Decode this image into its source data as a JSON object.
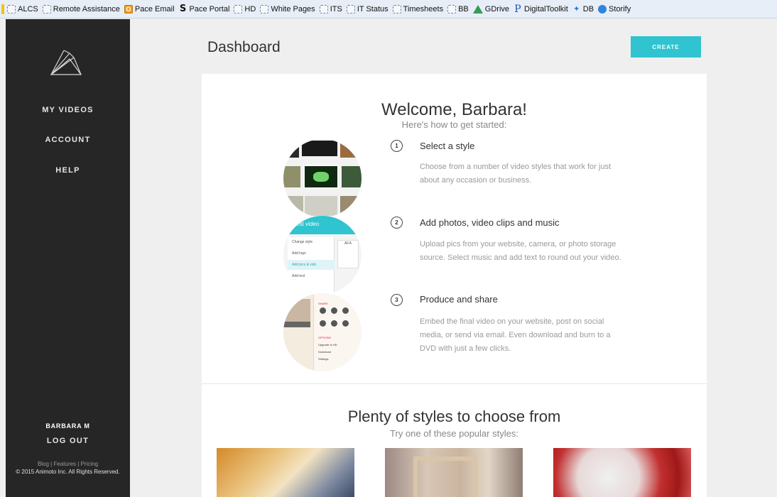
{
  "bookmarks": [
    {
      "label": "ALCS",
      "icon": "folder-icon"
    },
    {
      "label": "Remote Assistance",
      "icon": "folder-icon"
    },
    {
      "label": "Pace Email",
      "icon": "office-icon"
    },
    {
      "label": "Pace Portal",
      "icon": "s-icon"
    },
    {
      "label": "HD",
      "icon": "folder-icon"
    },
    {
      "label": "White Pages",
      "icon": "folder-icon"
    },
    {
      "label": "ITS",
      "icon": "folder-icon"
    },
    {
      "label": "IT Status",
      "icon": "folder-icon"
    },
    {
      "label": "Timesheets",
      "icon": "folder-icon"
    },
    {
      "label": "BB",
      "icon": "folder-icon"
    },
    {
      "label": "GDrive",
      "icon": "gdrive-icon"
    },
    {
      "label": "DigitalToolkit",
      "icon": "p-icon"
    },
    {
      "label": "DB",
      "icon": "dropbox-icon"
    },
    {
      "label": "Storify",
      "icon": "storify-icon"
    }
  ],
  "sidebar": {
    "nav": [
      "MY VIDEOS",
      "ACCOUNT",
      "HELP"
    ],
    "user_name": "BARBARA M",
    "logout": "LOG OUT",
    "footer_links": [
      "Blog",
      "Features",
      "Pricing"
    ],
    "copyright": "© 2015 Animoto Inc. All Rights Reserved."
  },
  "header": {
    "title": "Dashboard",
    "create_label": "CREATE"
  },
  "welcome": {
    "title": "Welcome, Barbara!",
    "subtitle": "Here's how to get started:"
  },
  "steps": [
    {
      "number": "1",
      "title": "Select a style",
      "description": "Choose from a number of video styles that work for just about any occasion or business."
    },
    {
      "number": "2",
      "title": "Add photos, video clips and music",
      "description": "Upload pics from your website, camera, or photo storage source. Select music and add text to round out your video."
    },
    {
      "number": "3",
      "title": "Produce and share",
      "description": "Embed the final video on your website, post on social media, or send via email. Even download and burn to a DVD with just a few clicks."
    }
  ],
  "step2_preview": {
    "header": "first video",
    "menu": [
      "Change style",
      "Add logo",
      "Add pics & vids",
      "Add text"
    ],
    "side_text": "All A"
  },
  "step3_preview": {
    "share_label": "SHARE",
    "share_items": [
      "Email",
      "Embed",
      "Twitter",
      "YouTube",
      "Embed",
      "More"
    ],
    "options_label": "OPTIONS",
    "options": [
      "Upgrade to HD",
      "Download",
      "Settings"
    ]
  },
  "styles": {
    "title": "Plenty of styles to choose from",
    "subtitle": "Try one of these popular styles:"
  },
  "colors": {
    "accent": "#2fc4cf",
    "sidebar_bg": "#262626",
    "page_bg": "#efefef"
  }
}
